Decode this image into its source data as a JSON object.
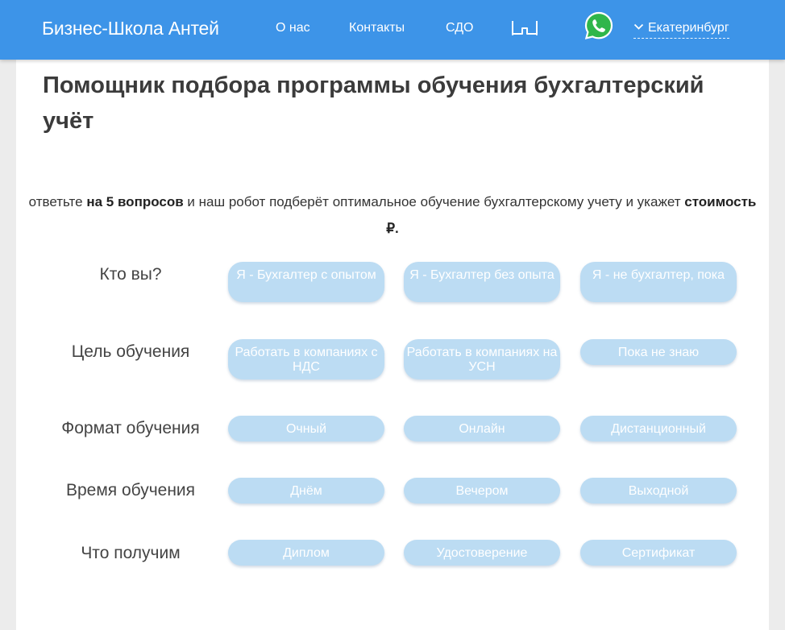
{
  "header": {
    "brand": "Бизнес-Школа Антей",
    "nav": [
      "О нас",
      "Контакты",
      "СДО"
    ],
    "icons": {
      "accessibility": "glasses-icon",
      "messenger": "whatsapp-icon",
      "city_chevron": "chevron-down-icon"
    },
    "city": "Екатеринбург",
    "colors": {
      "header_bg": "#3d94e8",
      "whatsapp_green": "#2fb64b",
      "option_bg": "#bcdcf3"
    }
  },
  "main": {
    "title": "Помощник подбора программы обучения бухгалтерский учёт",
    "intro": {
      "part1": "ответьте",
      "bold1": "на 5 вопросов",
      "part2": "и наш робот подберёт оптимальное обучение бухгалтерскому учету и укажет",
      "bold2": "стоимость ₽."
    },
    "questions": [
      {
        "label": "Кто вы?",
        "options": [
          "Я - Бухгалтер с опытом",
          "Я - Бухгалтер без опыта",
          "Я - не бухгалтер, пока"
        ]
      },
      {
        "label": "Цель обучения",
        "options": [
          "Работать в компаниях с НДС",
          "Работать в компаниях на УСН",
          "Пока не знаю"
        ]
      },
      {
        "label": "Формат обучения",
        "options": [
          "Очный",
          "Онлайн",
          "Дистанционный"
        ]
      },
      {
        "label": "Время обучения",
        "options": [
          "Днём",
          "Вечером",
          "Выходной"
        ]
      },
      {
        "label": "Что получим",
        "options": [
          "Диплом",
          "Удостоверение",
          "Сертификат"
        ]
      }
    ]
  }
}
